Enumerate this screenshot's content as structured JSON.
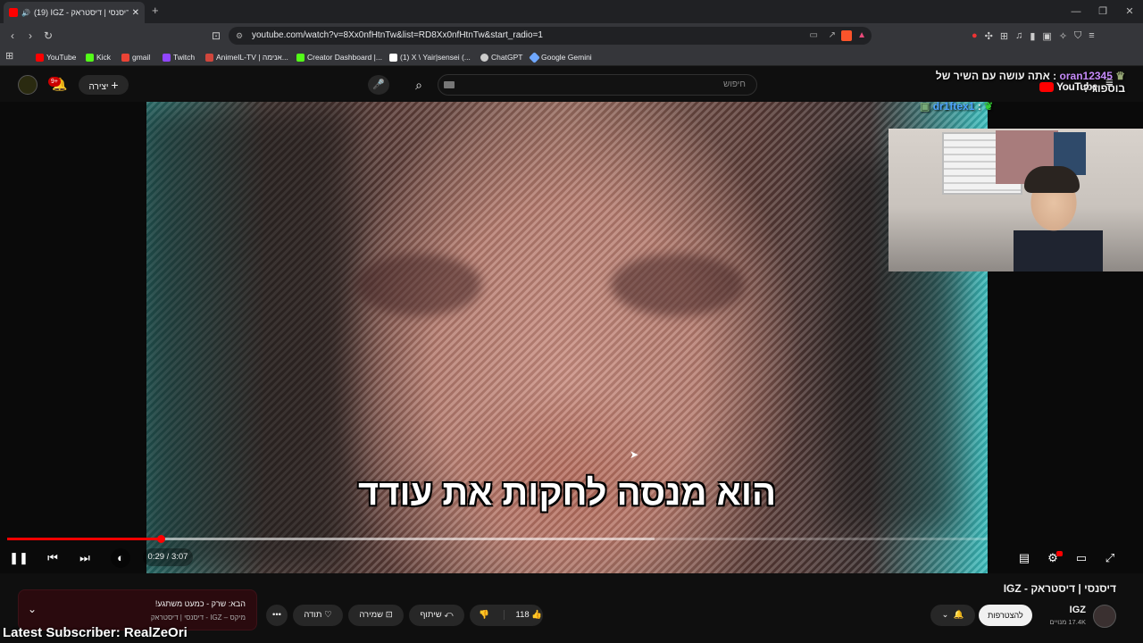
{
  "browser": {
    "tab_title": "(19) IGZ - דיסנסי | דיסטראק",
    "new_tab": "+",
    "url": "youtube.com/watch?v=8Xx0nfHtnTw&list=RD8Xx0nfHtnTw&start_radio=1",
    "bookmarks": [
      {
        "label": "YouTube",
        "color": "#ff0000"
      },
      {
        "label": "Kick",
        "color": "#53fc18"
      },
      {
        "label": "gmail",
        "color": "#ea4335"
      },
      {
        "label": "Twitch",
        "color": "#9146ff"
      },
      {
        "label": "AnimeIL-TV | אנימה...",
        "color": "#d0463c"
      },
      {
        "label": "Creator Dashboard |...",
        "color": "#53fc18"
      },
      {
        "label": "(1) X \\ Yair|sensei (...",
        "color": "#ffffff"
      },
      {
        "label": "ChatGPT",
        "color": "#cccccc"
      },
      {
        "label": "Google Gemini",
        "color": "#6fa8ff"
      }
    ]
  },
  "youtube": {
    "logo": "YouTube",
    "search_placeholder": "חיפוש",
    "create_label": "יצירה",
    "notif_badge": "9+"
  },
  "video": {
    "subtitle": "הוא מנסה לחקות את עודד",
    "time": "0:29 / 3:07",
    "progress_fraction": 0.157,
    "buffer_fraction": 0.66,
    "title": "דיסנסי | דיסטראק - IGZ"
  },
  "channel": {
    "name": "IGZ",
    "subscribers": "17.4K מנויים",
    "subscribe_label": "להצטרפות"
  },
  "actions": {
    "likes": "118",
    "share": "שיתוף",
    "save": "שמירה",
    "thanks": "תודה",
    "more": "•••"
  },
  "up_next": {
    "title": "הבא: שרק - כמעט משתגע!",
    "subtitle": "מיקס – IGZ - דיסנסי | דיסטראק"
  },
  "overlay": {
    "chat": [
      {
        "user": "oran12345",
        "message": "אתה עושה עם השיר של בוספוג ?"
      },
      {
        "user": "dr1ftex1",
        "message": ""
      }
    ],
    "latest_subscriber": "Latest Subscriber: RealZeOri"
  },
  "colors": {
    "accent": "#ff0000",
    "background": "#0f0f0f"
  }
}
